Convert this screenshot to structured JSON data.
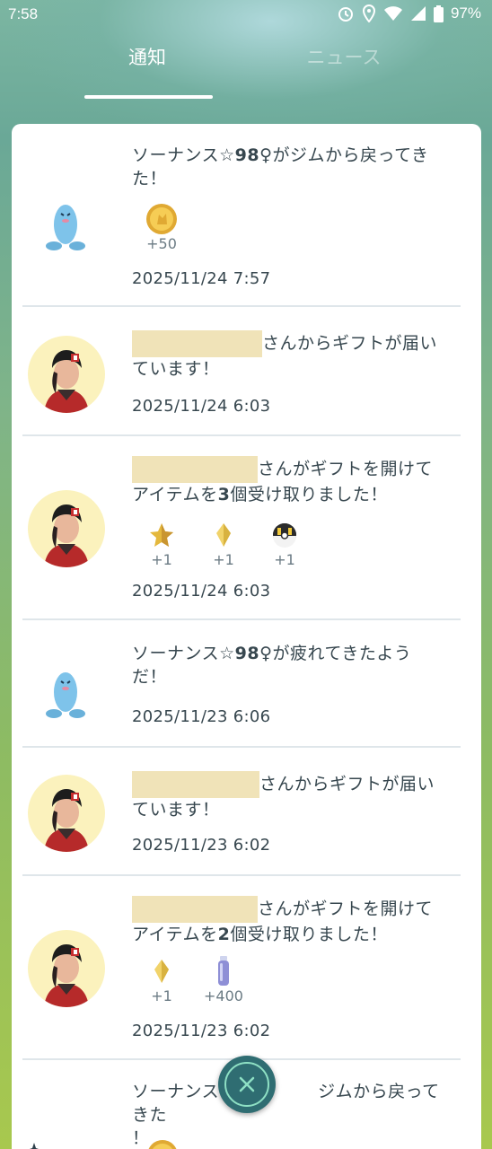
{
  "status_bar": {
    "time": "7:58",
    "battery": "97%"
  },
  "tabs": [
    {
      "label": "通知"
    },
    {
      "label": "ニュース"
    }
  ],
  "notifications": [
    {
      "prefix": "ソーナンス☆",
      "bold": "98",
      "suffix": "♀がジムから戻ってきた！",
      "rewards": [
        {
          "icon": "pokecoin-icon",
          "amount": "+50"
        }
      ],
      "date": "2025/11/24 7:57"
    },
    {
      "line1": "さんからギフトが届い",
      "line2": "ています！",
      "date": "2025/11/24 6:03"
    },
    {
      "line1": "さんがギフトを開けて",
      "line2_prefix": "アイテムを",
      "line2_bold": "3",
      "line2_suffix": "個受け取りました！",
      "rewards": [
        {
          "icon": "stardust-piece-icon",
          "amount": "+1"
        },
        {
          "icon": "candy-xl-icon",
          "amount": "+1"
        },
        {
          "icon": "ultra-ball-icon",
          "amount": "+1"
        }
      ],
      "date": "2025/11/24 6:03"
    },
    {
      "prefix": "ソーナンス☆",
      "bold": "98",
      "suffix": "♀が疲れてきたようだ！",
      "date": "2025/11/23 6:06"
    },
    {
      "line1": "さんからギフトが届い",
      "line2": "ています！",
      "date": "2025/11/23 6:02"
    },
    {
      "line1": "さんがギフトを開けて",
      "line2_prefix": "アイテムを",
      "line2_bold": "2",
      "line2_suffix": "個受け取りました！",
      "rewards": [
        {
          "icon": "candy-xl-icon",
          "amount": "+1"
        },
        {
          "icon": "potion-icon",
          "amount": "+400"
        }
      ],
      "date": "2025/11/23 6:02"
    },
    {
      "line1": "ソーナンス",
      "line1_end": "ジムから戻ってきた",
      "line2": "！"
    }
  ],
  "colors": {
    "card": "#ffffff",
    "text": "#37474f",
    "redaction": "#f0e3b8",
    "fab": "#2f6d72"
  }
}
